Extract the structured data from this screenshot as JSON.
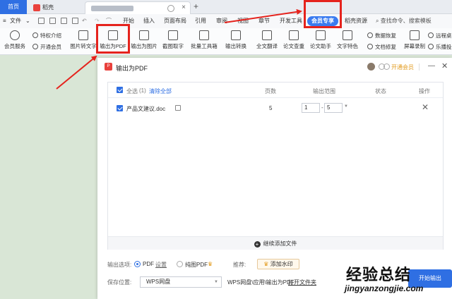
{
  "tabs": {
    "home": "首页",
    "doc": "稻壳"
  },
  "menu": {
    "file": "文件",
    "items": [
      "开始",
      "插入",
      "页面布局",
      "引用",
      "审阅",
      "视图",
      "章节",
      "开发工具",
      "会员专享",
      "稻壳资源"
    ],
    "search": "查找命令、搜索模板"
  },
  "toolbar": {
    "member_service": "会员服务",
    "privilege_intro": "特权介绍",
    "open_member": "开通会员",
    "img_to_text": "图片转文字",
    "export_pdf": "输出为PDF",
    "export_img": "输出为图片",
    "screenshot_ocr": "截图取字",
    "batch_tools": "批量工具箱",
    "export_convert": "输出转换",
    "full_translate": "全文翻译",
    "paper_check": "论文查重",
    "paper_assist": "论文助手",
    "text_feature": "文字特色",
    "data_recovery": "数据恢复",
    "doc_repair": "文档修复",
    "screen_record": "屏幕录制",
    "remote_desk": "远程桌",
    "le_play": "乐播投"
  },
  "dialog": {
    "title": "输出为PDF",
    "open_member": "开通会员",
    "header": {
      "select_all": "全选",
      "count": "(1)",
      "clear_all": "清除全部",
      "pages": "页数",
      "range": "输出范围",
      "status": "状态",
      "action": "操作"
    },
    "files": [
      {
        "name": "产品文建议.doc",
        "pages": "5",
        "from": "1",
        "to": "5"
      }
    ],
    "add_file": "继续添加文件",
    "options": {
      "label": "输出选项:",
      "pdf": "PDF",
      "settings": "设置",
      "image_pdf": "纯图PDF",
      "recommend": "推荐:",
      "add_watermark": "添加水印"
    },
    "save": {
      "label": "保存位置:",
      "location": "WPS网盘",
      "path": "WPS网盘\\应用\\输出为PDF",
      "open_folder": "打开文件夹"
    },
    "start": "开始输出"
  },
  "watermark": {
    "cn": "经验总结",
    "en": "jingyanzongjie.com"
  },
  "colors": {
    "accent": "#2f6fe3",
    "annotation_red": "#e5231d",
    "member_gold": "#e29a1c"
  }
}
